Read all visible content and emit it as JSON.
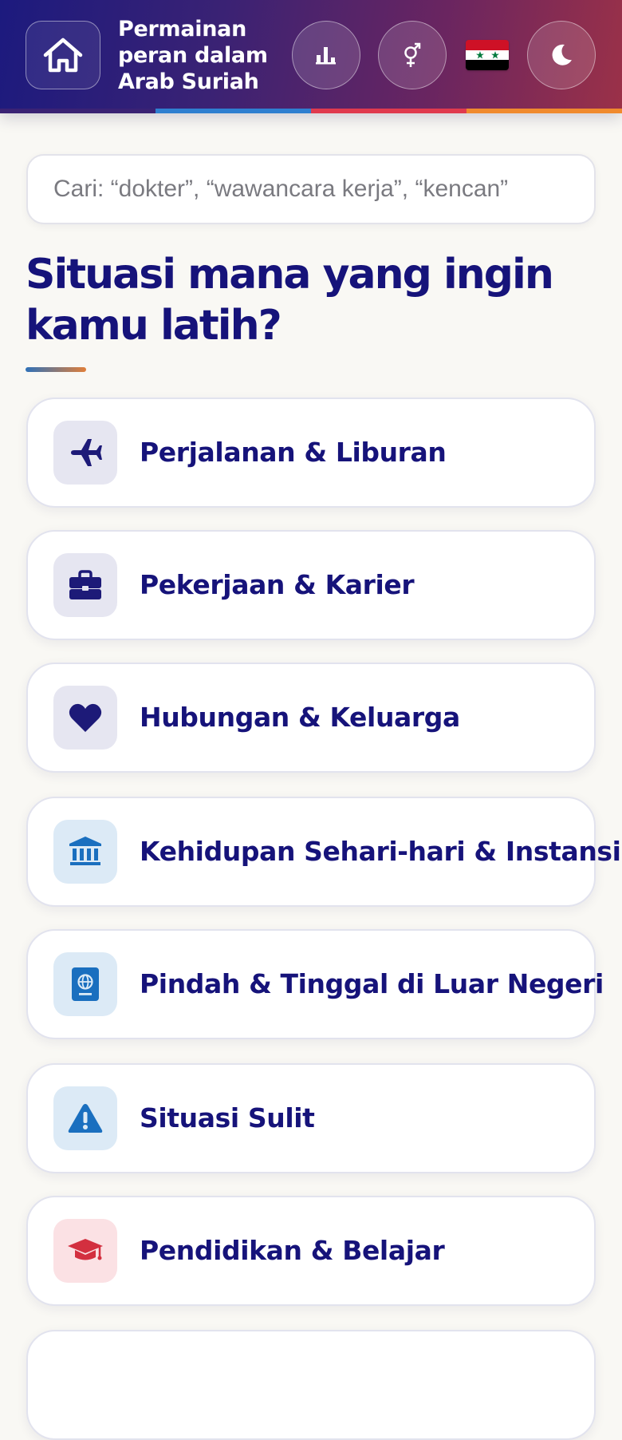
{
  "header": {
    "title": "Permainan peran dalam Arab Suriah",
    "home_icon": "home-icon",
    "stats_icon": "bar-chart-icon",
    "gender_icon": "gender-icon",
    "language_flag": "syria-flag",
    "theme_icon": "moon-icon",
    "stripe_colors": [
      "#3a2274",
      "#2f7fd0",
      "#e03a4e",
      "#f08a2e"
    ]
  },
  "search": {
    "placeholder": "Cari: “dokter”, “wawancara kerja”, “kencan”"
  },
  "main": {
    "heading": "Situasi mana yang ingin kamu latih?",
    "categories": [
      {
        "label": "Perjalanan & Liburan",
        "icon": "airplane-icon"
      },
      {
        "label": "Pekerjaan & Karier",
        "icon": "briefcase-icon"
      },
      {
        "label": "Hubungan & Keluarga",
        "icon": "heart-icon"
      },
      {
        "label": "Kehidupan Sehari-hari & Instansi",
        "icon": "bank-icon"
      },
      {
        "label": "Pindah & Tinggal di Luar Negeri",
        "icon": "passport-icon"
      },
      {
        "label": "Situasi Sulit",
        "icon": "warning-icon"
      },
      {
        "label": "Pendidikan & Belajar",
        "icon": "graduation-cap-icon"
      }
    ]
  },
  "colors": {
    "primary_text": "#16137a",
    "icon_bg_purple": "#e6e6f1",
    "icon_bg_blue": "#dceaf6",
    "icon_bg_red": "#fbe1e4",
    "icon_blue": "#1a6fbf",
    "icon_red": "#d32f3f"
  }
}
